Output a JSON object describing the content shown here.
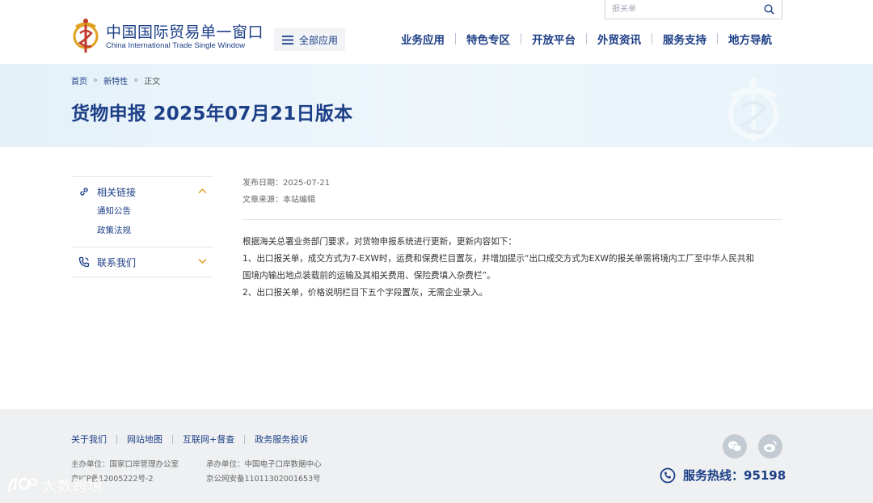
{
  "header": {
    "logo_cn": "中国国际贸易单一窗口",
    "logo_en": "China International Trade Single Window",
    "all_apps_label": "全部应用",
    "search_placeholder": "报关单",
    "nav": [
      "业务应用",
      "特色专区",
      "开放平台",
      "外贸资讯",
      "服务支持",
      "地方导航"
    ]
  },
  "breadcrumb": [
    "首页",
    "新特性",
    "正文"
  ],
  "breadcrumb_separator": "»",
  "page_title": "货物申报 2025年07月21日版本",
  "sidebar": {
    "related_links": {
      "label": "相关链接",
      "items": [
        "通知公告",
        "政策法规"
      ]
    },
    "contact": {
      "label": "联系我们"
    }
  },
  "article": {
    "publish_date": "发布日期：2025-07-21",
    "source": "文章来源：本站编辑",
    "paragraphs": [
      "根据海关总署业务部门要求，对货物申报系统进行更新，更新内容如下：",
      "1、出口报关单，成交方式为7-EXW时，运费和保费栏目置灰，并增加提示“出口成交方式为EXW的报关单需将境内工厂至中华人民共和",
      "国境内输出地点装载前的运输及其相关费用、保险费填入杂费栏”。",
      "2、出口报关单，价格说明栏目下五个字段置灰，无需企业录入。"
    ]
  },
  "footer": {
    "links": [
      "关于我们",
      "网站地图",
      "互联网+督查",
      "政务服务投诉"
    ],
    "host": "主办单位：国家口岸管理办公室",
    "icp": "京ICP备12005222号-2",
    "operator": "承办单位：中国电子口岸数据中心",
    "police": "京公网安备11011302001653号",
    "hotline": "服务热线：95198",
    "watermark": "大数跨境"
  },
  "colors": {
    "brand_blue": "#1d3f87",
    "accent_gold": "#e0a020",
    "banner_bg": "#e8f3fa",
    "footer_bg": "#eef0f2"
  }
}
